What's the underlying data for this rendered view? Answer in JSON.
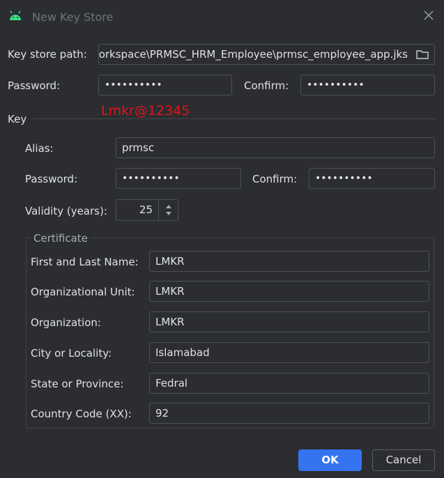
{
  "window": {
    "title": "New Key Store",
    "accent_color": "#3574f0",
    "overlay_color": "#e0141e"
  },
  "keystore": {
    "path_label": "Key store path:",
    "path_value": "orkspace\\PRMSC_HRM_Employee\\prmsc_employee_app.jks",
    "password_label": "Password:",
    "password_value": "••••••••••",
    "confirm_label": "Confirm:",
    "confirm_value": "••••••••••"
  },
  "overlay_text": "Lmkr@12345",
  "key": {
    "section_label": "Key",
    "alias_label": "Alias:",
    "alias_value": "prmsc",
    "password_label": "Password:",
    "password_value": "••••••••••",
    "confirm_label": "Confirm:",
    "confirm_value": "••••••••••",
    "validity_label": "Validity (years):",
    "validity_value": "25"
  },
  "certificate": {
    "section_label": "Certificate",
    "fields": [
      {
        "label": "First and Last Name:",
        "value": "LMKR"
      },
      {
        "label": "Organizational Unit:",
        "value": "LMKR"
      },
      {
        "label": "Organization:",
        "value": "LMKR"
      },
      {
        "label": "City or Locality:",
        "value": "Islamabad"
      },
      {
        "label": "State or Province:",
        "value": "Fedral"
      },
      {
        "label": "Country Code (XX):",
        "value": "92"
      }
    ]
  },
  "buttons": {
    "ok_label": "OK",
    "cancel_label": "Cancel"
  },
  "icons": [
    "android-icon",
    "close-icon",
    "folder-icon",
    "spinner-arrows-icon"
  ]
}
